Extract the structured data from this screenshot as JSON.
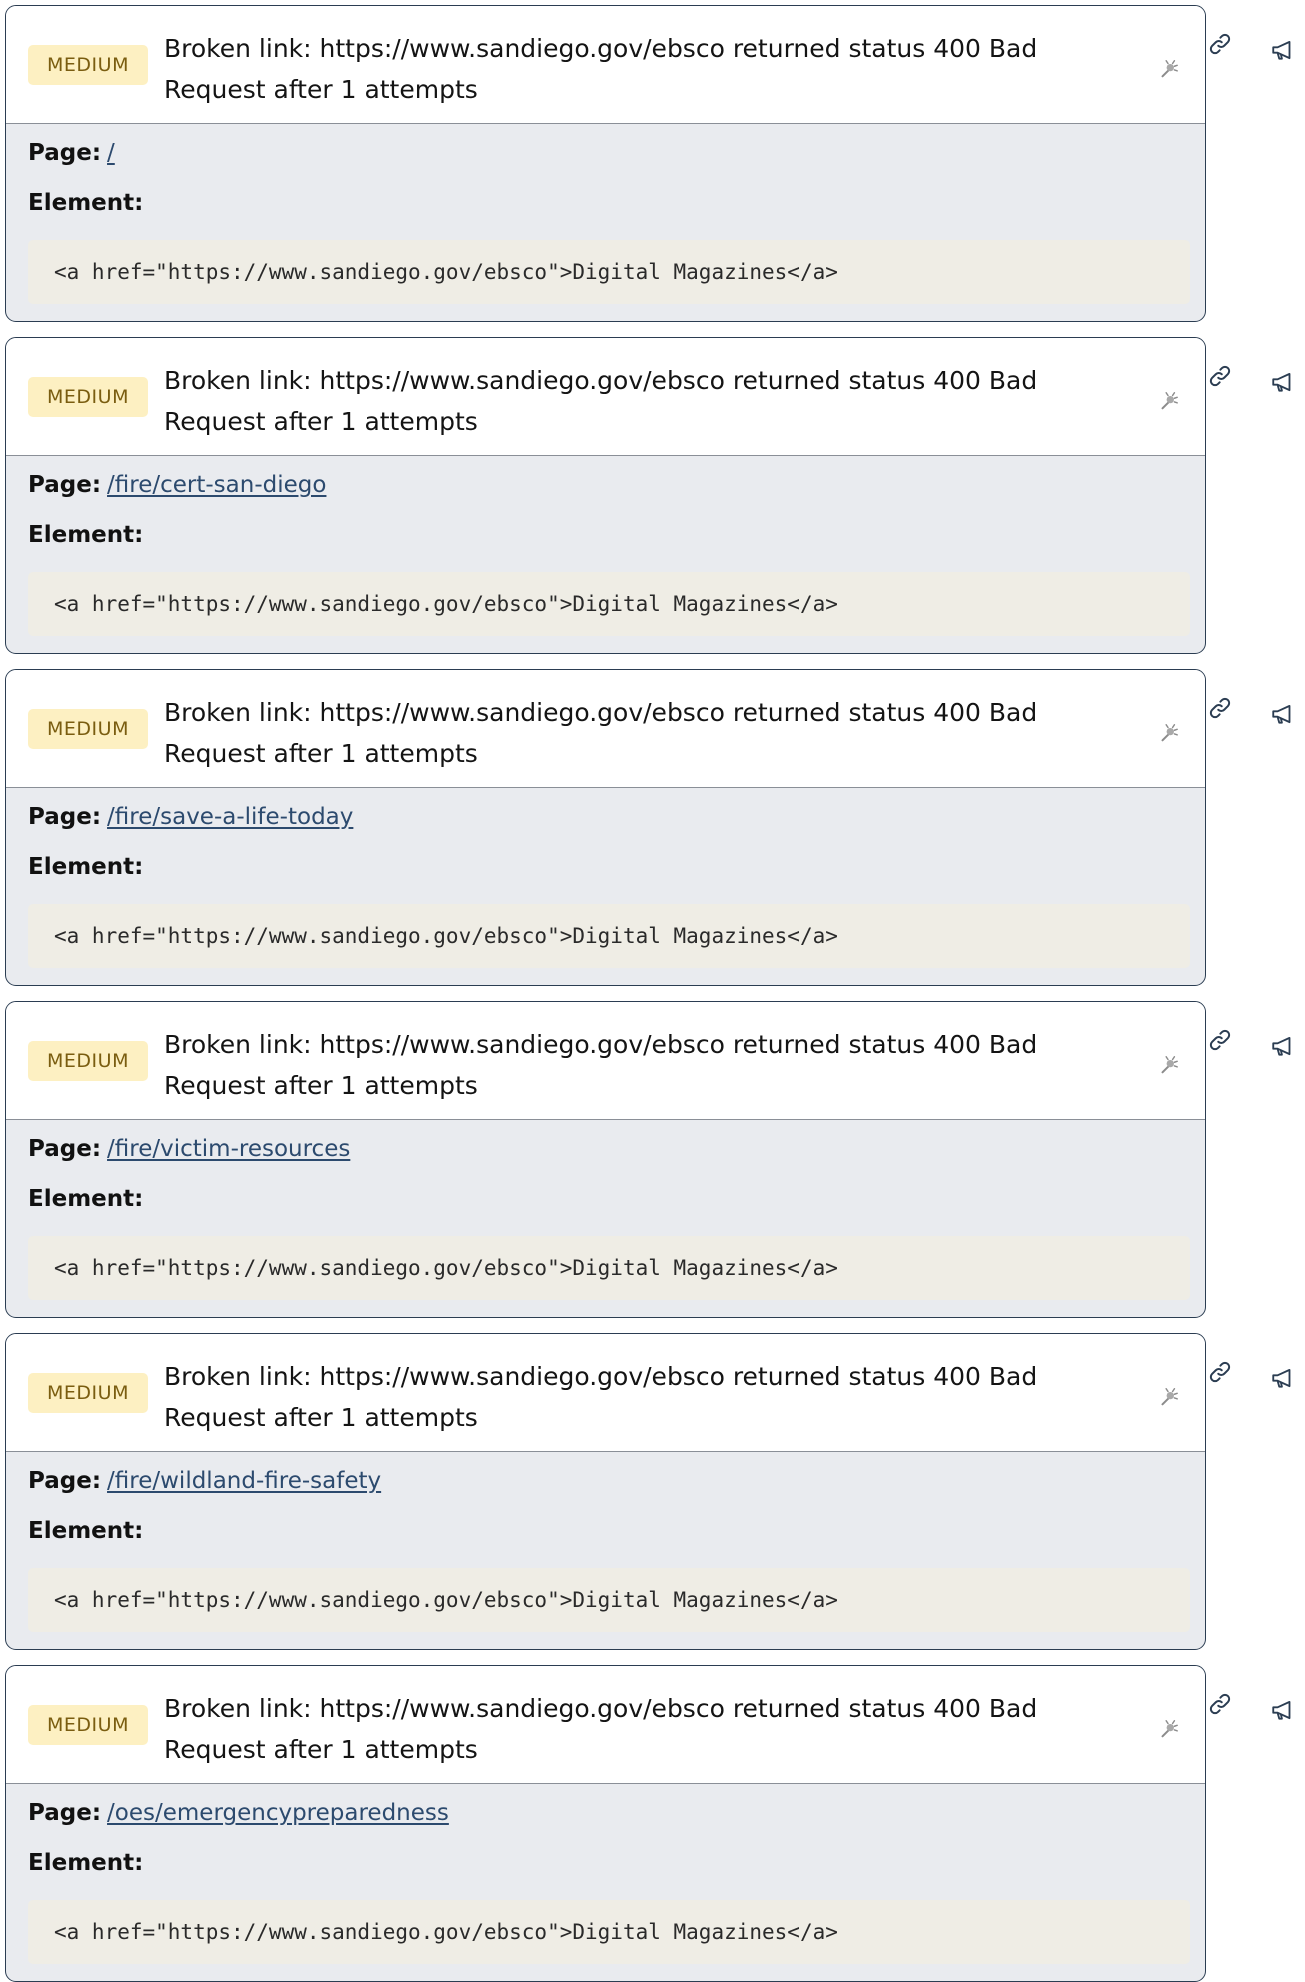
{
  "colors": {
    "card_border": "#2b3d52",
    "card_body_bg": "#e9ebef",
    "badge_bg": "#fdf0c2",
    "badge_text": "#7a5d10",
    "link": "#2c4a6e",
    "code_bg": "#efede5"
  },
  "icons": {
    "report": "bug-icon",
    "link": "link-icon",
    "announce": "megaphone-icon"
  },
  "labels": {
    "page": "Page:",
    "element": "Element:"
  },
  "issues": [
    {
      "severity": "MEDIUM",
      "message": "Broken link: https://www.sandiego.gov/ebsco returned status 400 Bad Request after 1 attempts",
      "page": "/",
      "element": "<a href=\"https://www.sandiego.gov/ebsco\">Digital Magazines</a>"
    },
    {
      "severity": "MEDIUM",
      "message": "Broken link: https://www.sandiego.gov/ebsco returned status 400 Bad Request after 1 attempts",
      "page": "/fire/cert-san-diego",
      "element": "<a href=\"https://www.sandiego.gov/ebsco\">Digital Magazines</a>"
    },
    {
      "severity": "MEDIUM",
      "message": "Broken link: https://www.sandiego.gov/ebsco returned status 400 Bad Request after 1 attempts",
      "page": "/fire/save-a-life-today",
      "element": "<a href=\"https://www.sandiego.gov/ebsco\">Digital Magazines</a>"
    },
    {
      "severity": "MEDIUM",
      "message": "Broken link: https://www.sandiego.gov/ebsco returned status 400 Bad Request after 1 attempts",
      "page": "/fire/victim-resources",
      "element": "<a href=\"https://www.sandiego.gov/ebsco\">Digital Magazines</a>"
    },
    {
      "severity": "MEDIUM",
      "message": "Broken link: https://www.sandiego.gov/ebsco returned status 400 Bad Request after 1 attempts",
      "page": "/fire/wildland-fire-safety",
      "element": "<a href=\"https://www.sandiego.gov/ebsco\">Digital Magazines</a>"
    },
    {
      "severity": "MEDIUM",
      "message": "Broken link: https://www.sandiego.gov/ebsco returned status 400 Bad Request after 1 attempts",
      "page": "/oes/emergencypreparedness",
      "element": "<a href=\"https://www.sandiego.gov/ebsco\">Digital Magazines</a>"
    }
  ]
}
